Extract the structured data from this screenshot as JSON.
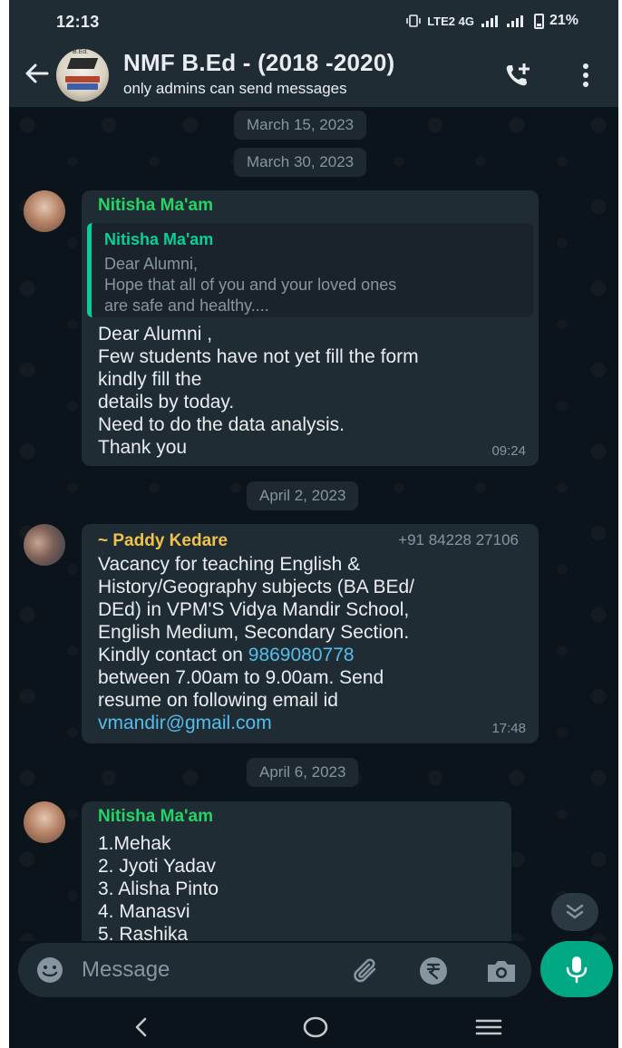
{
  "status_bar": {
    "time": "12:13",
    "network": "LTE2 4G",
    "battery": "21%"
  },
  "header": {
    "title": "NMF B.Ed - (2018 -2020)",
    "subtitle": "only admins can send messages",
    "avatar_label": "B.Ed."
  },
  "dates": [
    "March 15, 2023",
    "March 30, 2023",
    "April 2, 2023",
    "April 6, 2023"
  ],
  "messages": [
    {
      "sender": "Nitisha Ma'am",
      "sender_color": "#25d366",
      "quote": {
        "sender": "Nitisha Ma'am",
        "lines": [
          "Dear Alumni,",
          "Hope that all of you and your loved ones",
          "are safe and healthy...."
        ]
      },
      "lines": [
        "Dear Alumni ,",
        "Few students have not yet fill the form",
        "kindly fill the",
        "details by today.",
        "Need to do the data analysis.",
        "Thank you"
      ],
      "time": "09:24"
    },
    {
      "sender": "~ Paddy Kedare",
      "sender_color": "#f0c14b",
      "phone": "+91 84228 27106",
      "lines": [
        "Vacancy for teaching English &",
        "History/Geography subjects (BA BEd/",
        "DEd) in VPM'S Vidya Mandir School,",
        "English Medium, Secondary Section."
      ],
      "contact_prefix": "Kindly contact on ",
      "contact_number": "9869080778",
      "lines_after": [
        "between 7.00am to 9.00am. Send",
        "resume on following email id"
      ],
      "email": "vmandir@gmail.com",
      "time": "17:48"
    },
    {
      "sender": "Nitisha Ma'am",
      "sender_color": "#25d366",
      "lines": [
        "1.Mehak",
        "2. Jyoti Yadav",
        "3. Alisha Pinto",
        "4. Manasvi",
        "5. Rashika"
      ]
    }
  ],
  "input": {
    "placeholder": "Message"
  },
  "colors": {
    "background": "#0b141a",
    "header": "#1f2c34",
    "bubble": "#202c33",
    "accent": "#00a884",
    "link": "#53bdeb"
  }
}
